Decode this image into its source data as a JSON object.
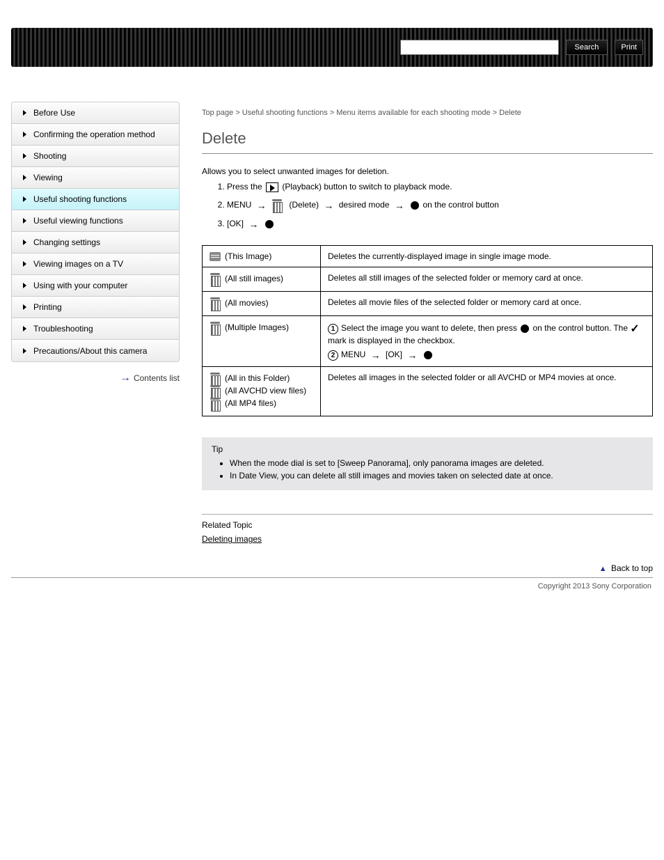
{
  "header": {
    "search_placeholder": "",
    "search_button": "Search",
    "print_button": "Print"
  },
  "sidebar": {
    "items": [
      {
        "label": "Before Use"
      },
      {
        "label": "Confirming the operation method"
      },
      {
        "label": "Shooting"
      },
      {
        "label": "Viewing"
      },
      {
        "label": "Useful shooting functions"
      },
      {
        "label": "Useful viewing functions"
      },
      {
        "label": "Changing settings"
      },
      {
        "label": "Viewing images on a TV"
      },
      {
        "label": "Using with your computer"
      },
      {
        "label": "Printing"
      },
      {
        "label": "Troubleshooting"
      },
      {
        "label": "Precautions/About this camera"
      }
    ],
    "active_index": 4,
    "contents_link": "Contents list"
  },
  "breadcrumb": "Top page  >  Useful shooting functions  >  Menu items available for each shooting mode  >  Delete",
  "main": {
    "title": "Delete",
    "lead": "Allows you to select unwanted images for deletion.",
    "steps": [
      {
        "parts": [
          "Press the ",
          "PLAYICON",
          " (Playback) button to switch to playback mode."
        ]
      },
      {
        "parts": [
          "MENU ",
          "ARROW",
          " ",
          "BIN",
          " (Delete) ",
          "ARROW",
          " desired mode ",
          "ARROW",
          " ",
          "DOT",
          " on the control button"
        ]
      },
      {
        "parts": [
          "[OK] ",
          "ARROW",
          " ",
          "DOT"
        ]
      }
    ],
    "table": [
      {
        "icon": "enc",
        "label": "(This Image)",
        "desc": "Deletes the currently-displayed image in single image mode."
      },
      {
        "icon": "bin",
        "label": "(All still images)",
        "desc": "Deletes all still images of the selected folder or memory card at once."
      },
      {
        "icon": "bin",
        "label": "(All movies)",
        "desc": "Deletes all movie files of the selected folder or memory card at once."
      },
      {
        "icon": "bin",
        "label": "(Multiple Images)",
        "desc_html": true,
        "step1_prefix": "Select the image you want to delete, then press ",
        "step1_mid": " on the control button. The ",
        "step1_suffix": " mark is displayed in the checkbox.",
        "step2_prefix": "MENU ",
        "step2_mid": " [OK] ",
        "step2_suffix": ""
      },
      {
        "icon": "bin",
        "multi": true,
        "labels": [
          "(All in this Folder)",
          "(All AVCHD view files)",
          "(All MP4 files)"
        ],
        "desc": "Deletes all images in the selected folder or all AVCHD or MP4 movies at once."
      }
    ],
    "tip_title": "Tip",
    "tips": [
      "When the mode dial is set to [Sweep Panorama], only panorama images are deleted.",
      "In Date View, you can delete all still images and movies taken on selected date at once."
    ],
    "related_title": "Related Topic",
    "related_link": "Deleting images",
    "back_top": "Back to top",
    "copyright": "Copyright 2013 Sony Corporation"
  }
}
